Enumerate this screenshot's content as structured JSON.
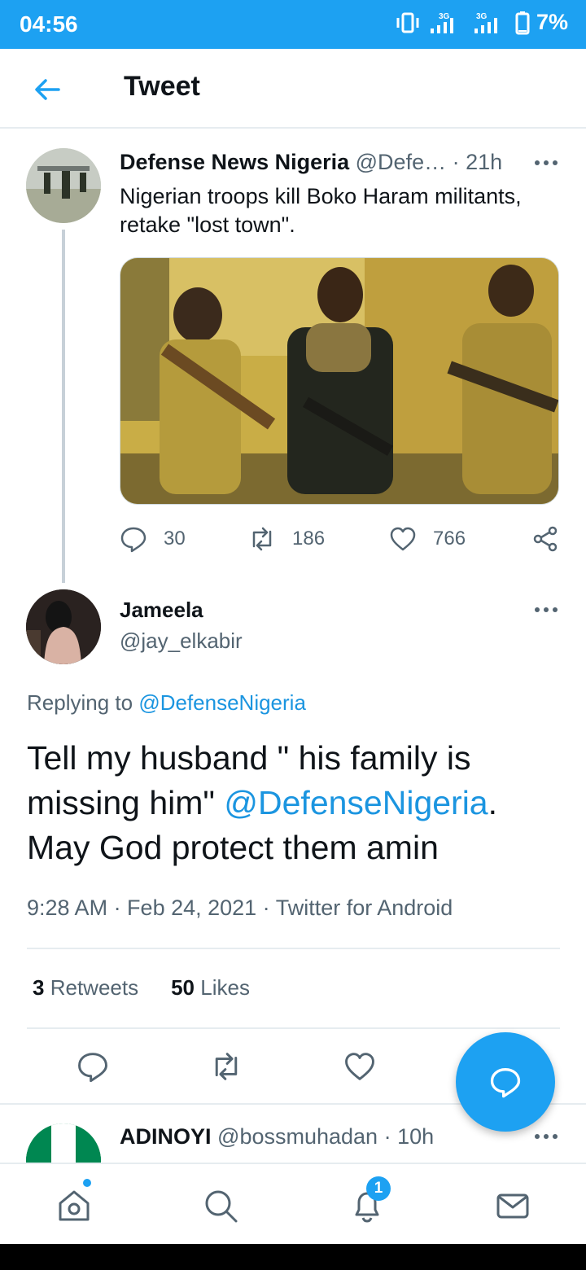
{
  "status_bar": {
    "time": "04:56",
    "battery": "7%",
    "network": "3G"
  },
  "header": {
    "title": "Tweet"
  },
  "parent_tweet": {
    "name": "Defense News Nigeria",
    "handle": "@Defe…",
    "age": "· 21h",
    "text": "Nigerian troops kill Boko Haram militants, retake \"lost town\".",
    "replies": "30",
    "retweets": "186",
    "likes": "766"
  },
  "main_tweet": {
    "name": "Jameela",
    "handle": "@jay_elkabir",
    "replying_prefix": "Replying to ",
    "replying_to": "@DefenseNigeria",
    "body_part1": "Tell my husband \" his family is missing him\" ",
    "body_mention": "@DefenseNigeria",
    "body_part2": ". May God protect them amin",
    "meta": "9:28 AM · Feb 24, 2021 · Twitter for Android",
    "retweets_count": "3",
    "retweets_label": "Retweets",
    "likes_count": "50",
    "likes_label": "Likes"
  },
  "next_reply": {
    "name": "ADINOYI",
    "handle": "@bossmuhadan",
    "age": "· 10h"
  },
  "bottom_nav": {
    "notifications_badge": "1"
  },
  "colors": {
    "accent": "#1da1f2",
    "link": "#1b95e0",
    "secondary_text": "#536471"
  }
}
